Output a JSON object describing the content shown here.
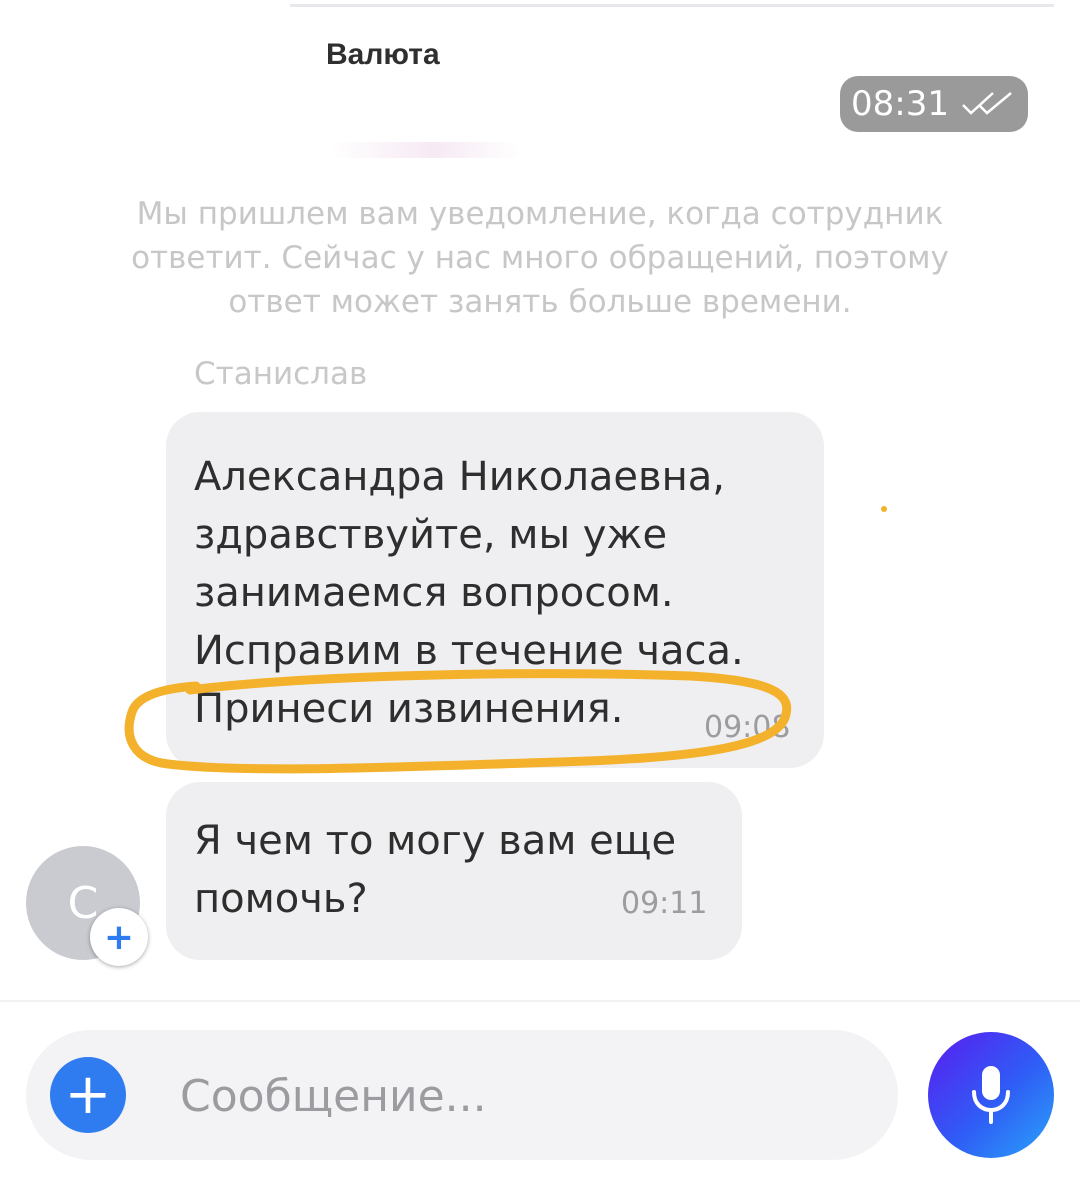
{
  "reply_preview": {
    "title": "Валюта",
    "time": "08:31"
  },
  "notice": "Мы пришлем вам уведомление, когда сотрудник ответит. Сейчас у нас много обращений, поэтому ответ может занять больше времени.",
  "sender_name": "Станислав",
  "messages": [
    {
      "text": "Александра Николаевна, здравствуйте, мы уже занимаемся вопросом. Исправим в течение часа. Принеси извинения.",
      "time": "09:08"
    },
    {
      "text": "Я чем то могу вам еще помочь?",
      "time": "09:11"
    }
  ],
  "avatar_letter": "С",
  "composer": {
    "placeholder": "Сообщение..."
  },
  "colors": {
    "accent_blue": "#2f7bf0",
    "highlight": "#f3b12c",
    "bubble": "#efeff1"
  },
  "icons": [
    "double-check-icon",
    "plus-icon",
    "microphone-icon"
  ]
}
